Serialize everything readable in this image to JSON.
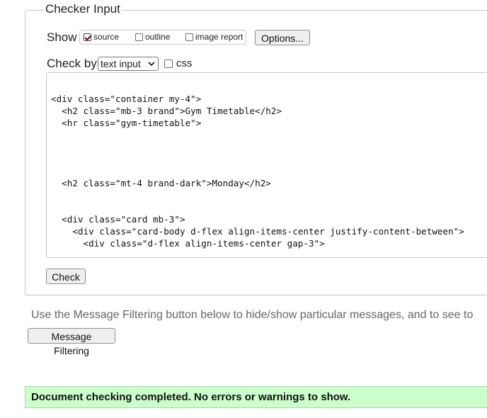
{
  "checker_input": {
    "legend": "Checker Input",
    "show_label": "Show",
    "show_options": [
      {
        "label": "source",
        "checked": true
      },
      {
        "label": "outline",
        "checked": false
      },
      {
        "label": "image report",
        "checked": false
      }
    ],
    "options_button": "Options...",
    "check_by_label": "Check by",
    "check_by_select": "text input",
    "css_label": "css",
    "css_checked": false,
    "source_lines": [
      "<div class=\"container my-4\">",
      "  <h2 class=\"mb-3 brand\">Gym Timetable</h2>",
      "  <hr class=\"gym-timetable\">",
      "",
      "",
      "",
      "",
      "  <h2 class=\"mt-4 brand-dark\">Monday</h2>",
      "",
      "",
      "  <div class=\"card mb-3\">",
      "    <div class=\"card-body d-flex align-items-center justify-content-between\">",
      "      <div class=\"d-flex align-items-center gap-3\">"
    ],
    "check_button": "Check"
  },
  "message_filtering": {
    "hint": "Use the Message Filtering button below to hide/show particular messages, and to see to",
    "button": "Message Filtering"
  },
  "result": {
    "message": "Document checking completed. No errors or warnings to show.",
    "color": "#ccffcc"
  }
}
